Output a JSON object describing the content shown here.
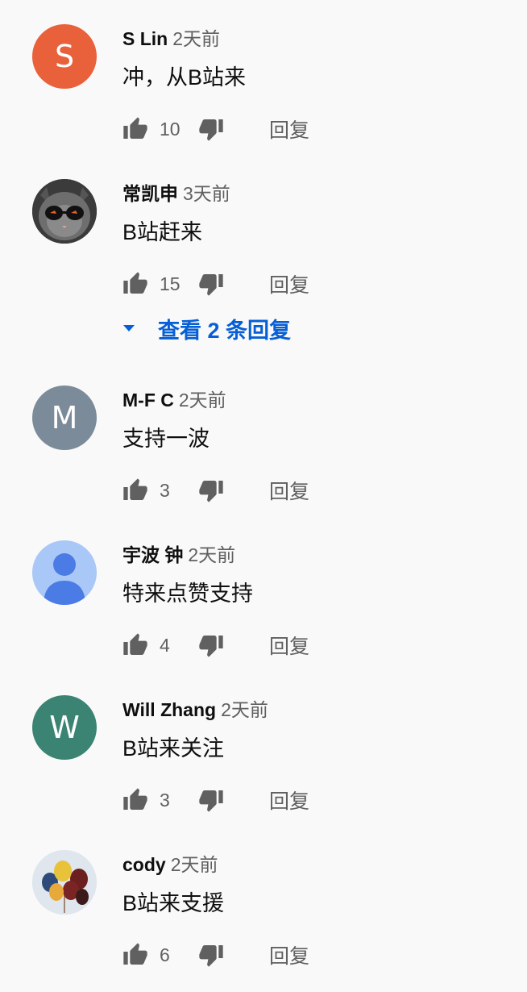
{
  "comments": [
    {
      "author": "S Lin",
      "time": "2天前",
      "text": "冲，从B站来",
      "likes": "10",
      "reply_label": "回复",
      "avatar": {
        "type": "letter",
        "letter": "S",
        "color": "#e8613a"
      }
    },
    {
      "author": "常凯申",
      "time": "3天前",
      "text": "B站赶来",
      "likes": "15",
      "reply_label": "回复",
      "avatar": {
        "type": "image",
        "depicts": "cat-with-sunglasses"
      }
    },
    {
      "author": "M-F C",
      "time": "2天前",
      "text": "支持一波",
      "likes": "3",
      "reply_label": "回复",
      "avatar": {
        "type": "letter",
        "letter": "M",
        "color": "#7c8b9a"
      }
    },
    {
      "author": "宇波 钟",
      "time": "2天前",
      "text": "特来点赞支持",
      "likes": "4",
      "reply_label": "回复",
      "avatar": {
        "type": "default-person",
        "color": "#a9c7f7"
      }
    },
    {
      "author": "Will Zhang",
      "time": "2天前",
      "text": "B站来关注",
      "likes": "3",
      "reply_label": "回复",
      "avatar": {
        "type": "letter",
        "letter": "W",
        "color": "#3b8474"
      }
    },
    {
      "author": "cody",
      "time": "2天前",
      "text": "B站来支援",
      "likes": "6",
      "reply_label": "回复",
      "avatar": {
        "type": "image",
        "depicts": "balloons"
      }
    }
  ],
  "view_replies": {
    "label": "查看 2 条回复",
    "link_color": "#065fd4"
  },
  "icons": {
    "like": "thumbs-up-icon",
    "dislike": "thumbs-down-icon",
    "expand": "caret-down-icon"
  }
}
